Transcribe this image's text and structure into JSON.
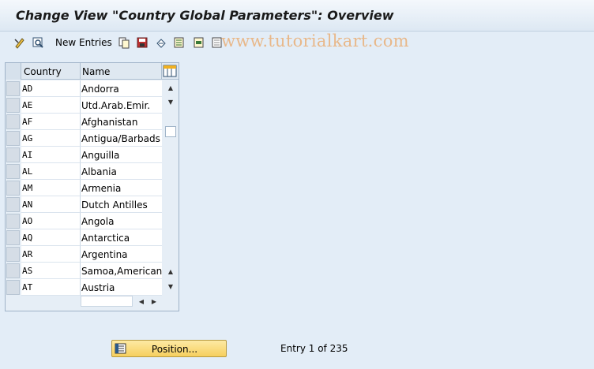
{
  "window": {
    "title": "Change View \"Country Global Parameters\": Overview"
  },
  "toolbar": {
    "new_entries_label": "New Entries",
    "icons": [
      "display-change-icon",
      "details-icon",
      "copy-icon",
      "save-icon",
      "undo-icon",
      "select-all-icon",
      "select-block-icon",
      "deselect-all-icon"
    ]
  },
  "watermark": "www.tutorialkart.com",
  "table": {
    "columns": [
      "Country",
      "Name"
    ],
    "rows": [
      {
        "country": "AD",
        "name": "Andorra"
      },
      {
        "country": "AE",
        "name": "Utd.Arab.Emir."
      },
      {
        "country": "AF",
        "name": "Afghanistan"
      },
      {
        "country": "AG",
        "name": "Antigua/Barbads"
      },
      {
        "country": "AI",
        "name": "Anguilla"
      },
      {
        "country": "AL",
        "name": "Albania"
      },
      {
        "country": "AM",
        "name": "Armenia"
      },
      {
        "country": "AN",
        "name": "Dutch Antilles"
      },
      {
        "country": "AO",
        "name": "Angola"
      },
      {
        "country": "AQ",
        "name": "Antarctica"
      },
      {
        "country": "AR",
        "name": "Argentina"
      },
      {
        "country": "AS",
        "name": "Samoa,American"
      },
      {
        "country": "AT",
        "name": "Austria"
      }
    ]
  },
  "footer": {
    "position_label": "Position...",
    "entry_text": "Entry 1 of 235"
  },
  "colors": {
    "accent": "#f6cf5e",
    "background": "#e3edf7",
    "watermark": "#e8b88a"
  }
}
